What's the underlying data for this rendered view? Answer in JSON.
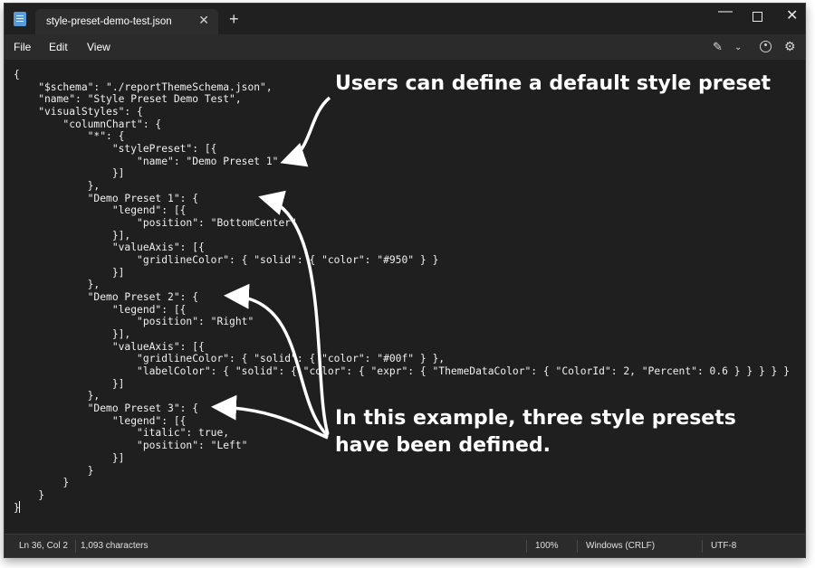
{
  "window": {
    "tab_title": "style-preset-demo-test.json",
    "tab_close_glyph": "✕",
    "new_tab_glyph": "+",
    "min_glyph": "—",
    "close_glyph": "✕"
  },
  "menu": {
    "file": "File",
    "edit": "Edit",
    "view": "View",
    "copilot_icon": "pen-sparkle-icon",
    "copilot_glyph": "✎",
    "chevron_glyph": "⌄",
    "account_icon": "account-icon",
    "settings_icon": "gear-icon",
    "settings_glyph": "⚙"
  },
  "editor": {
    "content": "{\n    \"$schema\": \"./reportThemeSchema.json\",\n    \"name\": \"Style Preset Demo Test\",\n    \"visualStyles\": {\n        \"columnChart\": {\n            \"*\": {\n                \"stylePreset\": [{\n                    \"name\": \"Demo Preset 1\"\n                }]\n            },\n            \"Demo Preset 1\": {\n                \"legend\": [{\n                    \"position\": \"BottomCenter\"\n                }],\n                \"valueAxis\": [{\n                    \"gridlineColor\": { \"solid\": { \"color\": \"#950\" } }\n                }]\n            },\n            \"Demo Preset 2\": {\n                \"legend\": [{\n                    \"position\": \"Right\"\n                }],\n                \"valueAxis\": [{\n                    \"gridlineColor\": { \"solid\": { \"color\": \"#00f\" } },\n                    \"labelColor\": { \"solid\": { \"color\": { \"expr\": { \"ThemeDataColor\": { \"ColorId\": 2, \"Percent\": 0.6 } } } } }\n                }]\n            },\n            \"Demo Preset 3\": {\n                \"legend\": [{\n                    \"italic\": true,\n                    \"position\": \"Left\"\n                }]\n            }\n        }\n    }\n}"
  },
  "callouts": {
    "top": "Users can define a default style preset",
    "bottom": "In this example, three style presets have been defined."
  },
  "status": {
    "position": "Ln 36, Col 2",
    "characters": "1,093 characters",
    "zoom": "100%",
    "line_endings": "Windows (CRLF)",
    "encoding": "UTF-8"
  }
}
